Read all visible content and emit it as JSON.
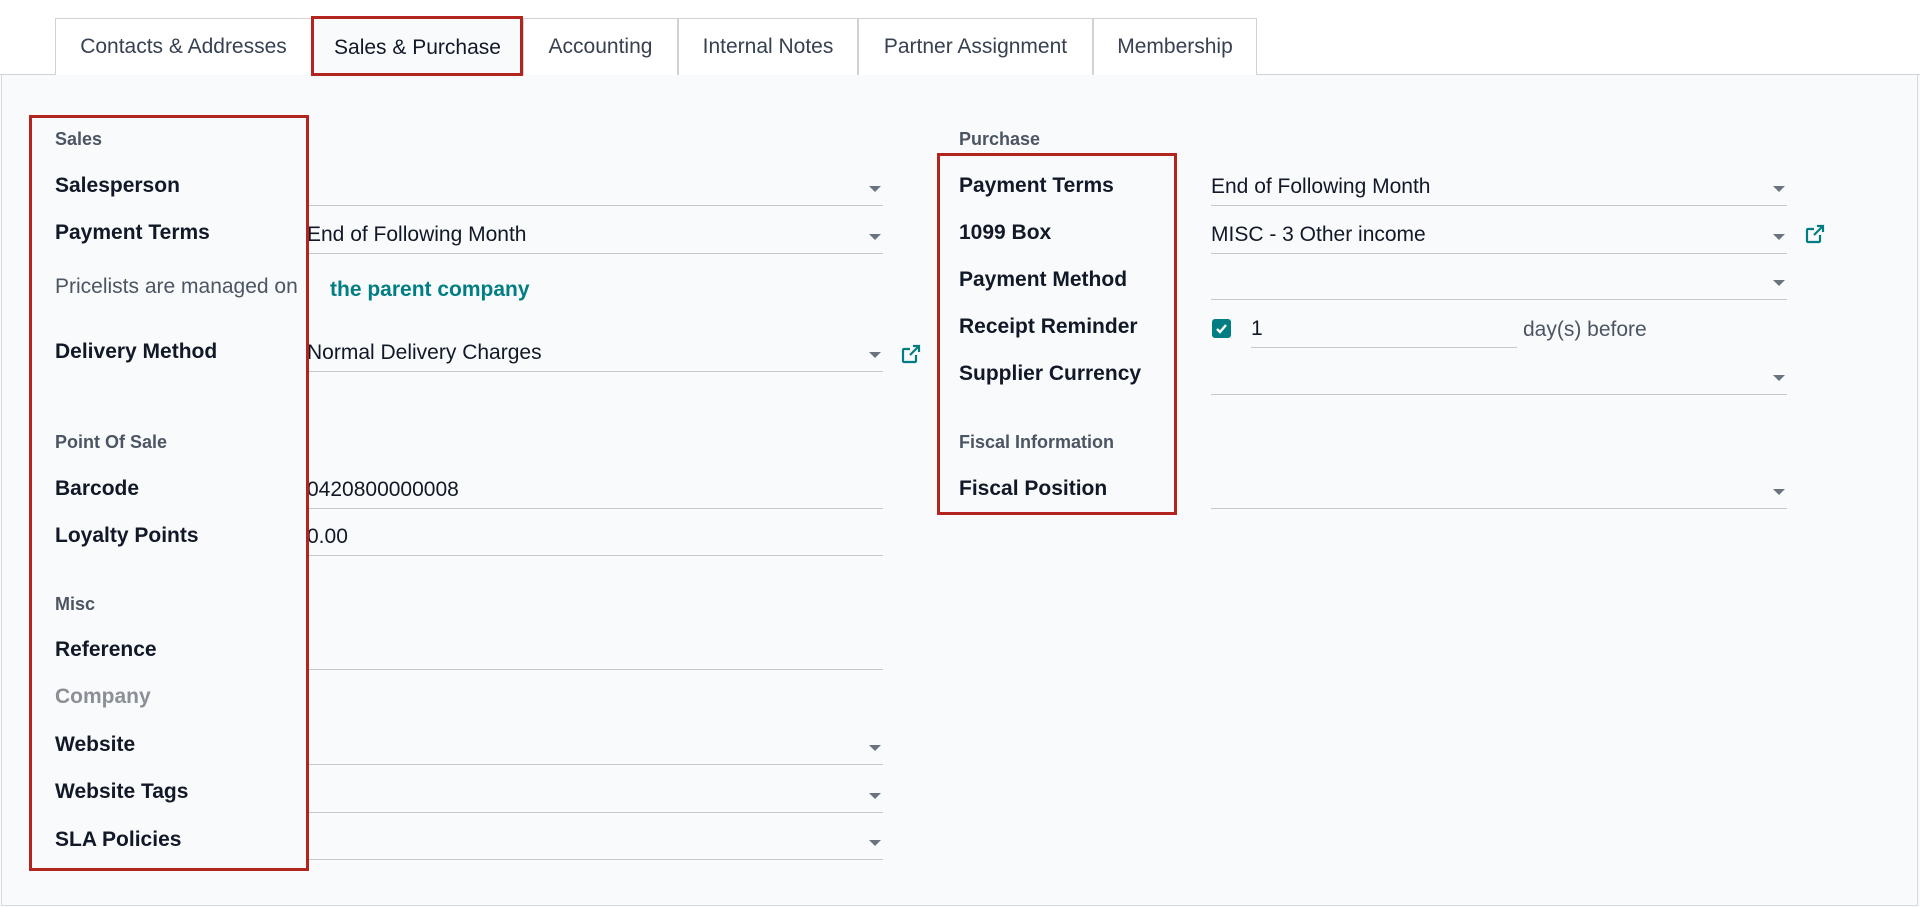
{
  "tabs": [
    {
      "label": "Contacts & Addresses"
    },
    {
      "label": "Sales & Purchase"
    },
    {
      "label": "Accounting"
    },
    {
      "label": "Internal Notes"
    },
    {
      "label": "Partner Assignment"
    },
    {
      "label": "Membership"
    }
  ],
  "active_tab": "Sales & Purchase",
  "sales": {
    "section_title": "Sales",
    "salesperson": {
      "label": "Salesperson",
      "value": ""
    },
    "payment_terms": {
      "label": "Payment Terms",
      "value": "End of Following Month"
    },
    "pricelist_note": "Pricelists are managed on",
    "pricelist_link": "the parent company",
    "delivery_method": {
      "label": "Delivery Method",
      "value": "Normal Delivery Charges"
    }
  },
  "point_of_sale": {
    "section_title": "Point Of Sale",
    "barcode": {
      "label": "Barcode",
      "value": "0420800000008"
    },
    "loyalty_points": {
      "label": "Loyalty Points",
      "value": "0.00"
    }
  },
  "misc": {
    "section_title": "Misc",
    "reference": {
      "label": "Reference",
      "value": ""
    },
    "company": {
      "label": "Company"
    },
    "website": {
      "label": "Website",
      "value": ""
    },
    "website_tags": {
      "label": "Website Tags",
      "value": ""
    },
    "sla_policies": {
      "label": "SLA Policies",
      "value": ""
    }
  },
  "purchase": {
    "section_title": "Purchase",
    "payment_terms": {
      "label": "Payment Terms",
      "value": "End of Following Month"
    },
    "box_1099": {
      "label": "1099 Box",
      "value": "MISC - 3 Other income"
    },
    "payment_method": {
      "label": "Payment Method",
      "value": ""
    },
    "receipt_reminder": {
      "label": "Receipt Reminder",
      "checked": true,
      "days": "1",
      "suffix": "day(s) before"
    },
    "supplier_currency": {
      "label": "Supplier Currency",
      "value": ""
    }
  },
  "fiscal": {
    "section_title": "Fiscal Information",
    "fiscal_position": {
      "label": "Fiscal Position",
      "value": ""
    }
  },
  "colors": {
    "accent": "#017e84",
    "highlight": "#b3241f"
  }
}
